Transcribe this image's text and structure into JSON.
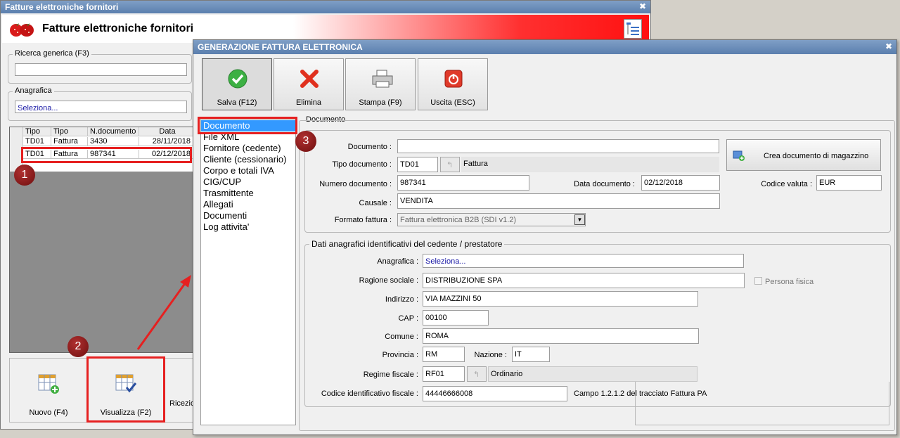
{
  "back_window": {
    "title": "Fatture elettroniche fornitori",
    "header_title": "Fatture elettroniche fornitori",
    "search_label": "Ricerca generica (F3)",
    "search_value": "",
    "anagrafica_label": "Anagrafica",
    "anagrafica_value": "Seleziona...",
    "grid": {
      "columns": [
        "Tipo",
        "Tipo",
        "N.documento",
        "Data"
      ],
      "rows": [
        [
          "TD01",
          "Fattura",
          "3430",
          "28/11/2018"
        ],
        [
          "TD01",
          "Fattura",
          "987341",
          "02/12/2018"
        ]
      ]
    },
    "buttons": {
      "new": "Nuovo (F4)",
      "view": "Visualizza (F2)",
      "receive": "Ricezio"
    }
  },
  "dialog": {
    "title": "GENERAZIONE FATTURA ELETTRONICA",
    "toolbar": {
      "save": "Salva (F12)",
      "delete": "Elimina",
      "print": "Stampa (F9)",
      "exit": "Uscita (ESC)"
    },
    "nav": [
      "Documento",
      "File XML",
      "Fornitore (cedente)",
      "Cliente (cessionario)",
      "Corpo e totali IVA",
      "CIG/CUP",
      "Trasmittente",
      "Allegati",
      "Documenti",
      "Log attivita'"
    ],
    "section_title": "Documento",
    "documento": {
      "documento_label": "Documento :",
      "documento_value": "",
      "tipo_label": "Tipo documento :",
      "tipo_code": "TD01",
      "tipo_desc": "Fattura",
      "numero_label": "Numero documento :",
      "numero_value": "987341",
      "data_label": "Data documento :",
      "data_value": "02/12/2018",
      "causale_label": "Causale :",
      "causale_value": "VENDITA",
      "formato_label": "Formato fattura :",
      "formato_value": "Fattura elettronica B2B (SDI v1.2)",
      "crea_button": "Crea documento di magazzino",
      "valuta_label": "Codice valuta :",
      "valuta_value": "EUR"
    },
    "cedente": {
      "group_title": "Dati anagrafici identificativi del cedente / prestatore",
      "anagrafica_label": "Anagrafica :",
      "anagrafica_value": "Seleziona...",
      "ragione_label": "Ragione sociale :",
      "ragione_value": "DISTRIBUZIONE SPA",
      "persona_fisica_label": "Persona fisica",
      "indirizzo_label": "Indirizzo :",
      "indirizzo_value": "VIA MAZZINI 50",
      "cap_label": "CAP :",
      "cap_value": "00100",
      "comune_label": "Comune :",
      "comune_value": "ROMA",
      "provincia_label": "Provincia :",
      "provincia_value": "RM",
      "nazione_label": "Nazione :",
      "nazione_value": "IT",
      "regime_label": "Regime fiscale :",
      "regime_code": "RF01",
      "regime_desc": "Ordinario",
      "codice_label": "Codice identificativo fiscale :",
      "codice_value": "44446666008",
      "codice_note": "Campo 1.2.1.2 del tracciato Fattura PA"
    }
  },
  "annotations": {
    "marker1": "1",
    "marker2": "2",
    "marker3": "3"
  }
}
